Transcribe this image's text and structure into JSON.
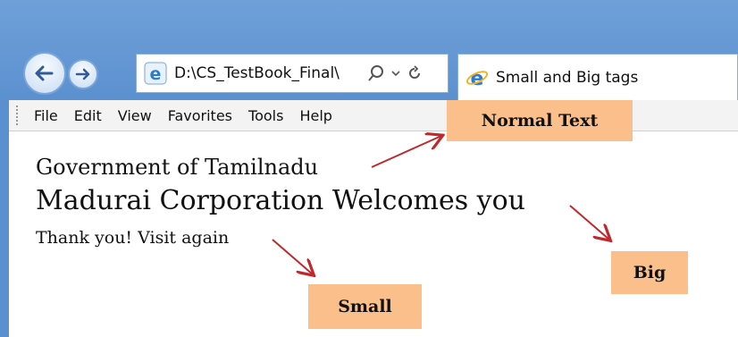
{
  "browser": {
    "address": "D:\\CS_TestBook_Final\\",
    "tab_title": "Small and Big tags",
    "accent_color": "#5b90d0"
  },
  "menubar": {
    "items": [
      "File",
      "Edit",
      "View",
      "Favorites",
      "Tools",
      "Help"
    ]
  },
  "page": {
    "normal_text": "Government of Tamilnadu",
    "big_text": "Madurai Corporation Welcomes you",
    "small_text": "Thank you! Visit again"
  },
  "callouts": {
    "normal": "Normal Text",
    "big": "Big",
    "small": "Small",
    "fill_color": "#fbbf8c",
    "arrow_color": "#c0282d"
  },
  "icons": [
    "back-icon",
    "forward-icon",
    "ie-logo-icon",
    "search-icon",
    "dropdown-icon",
    "refresh-icon"
  ]
}
